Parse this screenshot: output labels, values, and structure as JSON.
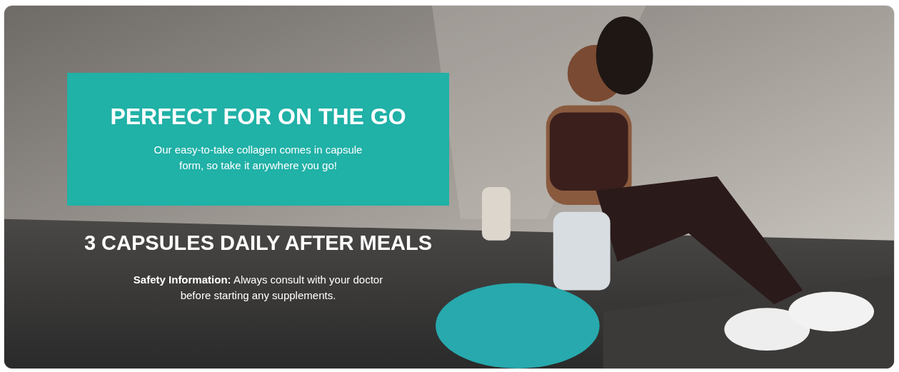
{
  "banner": {
    "callout": {
      "title": "PERFECT FOR ON THE GO",
      "text": "Our easy-to-take collagen comes in capsule form, so take it anywhere you go!"
    },
    "heading": "3 CAPSULES DAILY AFTER MEALS",
    "safety": "**Safety Information:** Always consult with your doctor before starting any supplements."
  }
}
